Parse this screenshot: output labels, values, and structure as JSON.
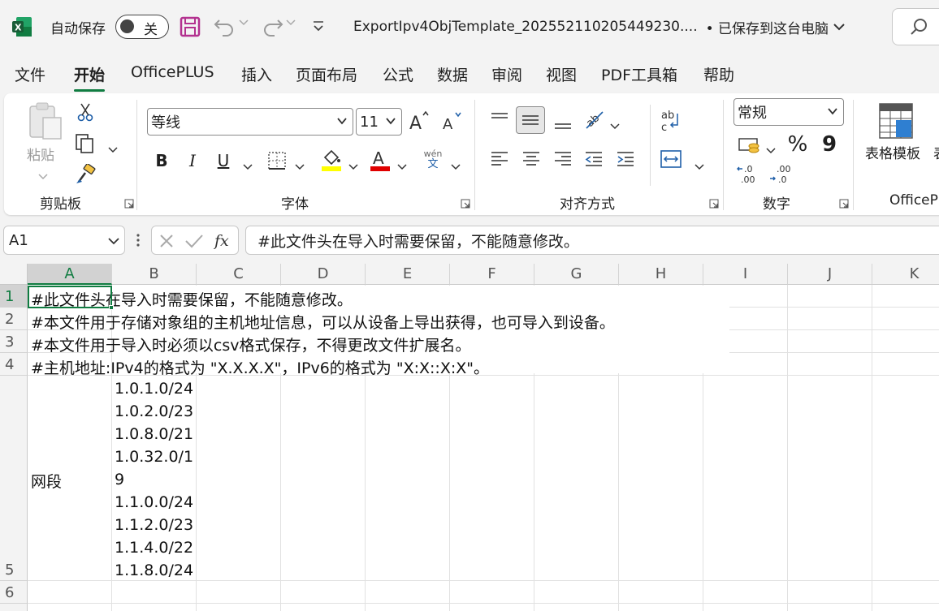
{
  "titlebar": {
    "autosave_label": "自动保存",
    "toggle_state": "关",
    "filename": "ExportIpv4ObjTemplate_202552110205449230....",
    "save_status": "• 已保存到这台电脑"
  },
  "menu": {
    "tabs": [
      "文件",
      "开始",
      "OfficePLUS",
      "插入",
      "页面布局",
      "公式",
      "数据",
      "审阅",
      "视图",
      "PDF工具箱",
      "帮助"
    ],
    "active": "开始"
  },
  "ribbon": {
    "clipboard": {
      "paste_label": "粘贴",
      "group_label": "剪贴板"
    },
    "font": {
      "font_name": "等线",
      "font_size": "11",
      "group_label": "字体",
      "phonetic_top": "wén",
      "phonetic_bottom": "文",
      "bold": "B",
      "italic": "I",
      "underline": "U"
    },
    "alignment": {
      "group_label": "对齐方式"
    },
    "number": {
      "format": "常规",
      "group_label": "数字",
      "percent": "%",
      "comma": "9"
    },
    "tables": {
      "template_label": "表格模板",
      "cut_label": "表",
      "group_label": "OfficeP"
    },
    "colors": {
      "accent": "#107c41",
      "highlight": "#ffff00",
      "font_color": "#e00000"
    }
  },
  "formula_bar": {
    "name_box": "A1",
    "content": "#此文件头在导入时需要保留，不能随意修改。"
  },
  "sheet": {
    "columns": [
      "A",
      "B",
      "C",
      "D",
      "E",
      "F",
      "G",
      "H",
      "I",
      "J",
      "K"
    ],
    "rows": [
      "1",
      "2",
      "3",
      "4",
      "5",
      "6"
    ],
    "cells": {
      "A1": "#此文件头在导入时需要保留，不能随意修改。",
      "A2": "#本文件用于存储对象组的主机地址信息，可以从设备上导出获得，也可导入到设备。",
      "A3": "#本文件用于导入时必须以csv格式保存，不得更改文件扩展名。",
      "A4": "#主机地址:IPv4的格式为 \"X.X.X.X\"，IPv6的格式为 \"X:X::X:X\"。",
      "A5": "网段",
      "B5_lines": [
        "1.0.1.0/24",
        "1.0.2.0/23",
        "1.0.8.0/21",
        "1.0.32.0/1",
        "9",
        "1.1.0.0/24",
        "1.1.2.0/23",
        "1.1.4.0/22",
        "1.1.8.0/24"
      ]
    }
  }
}
